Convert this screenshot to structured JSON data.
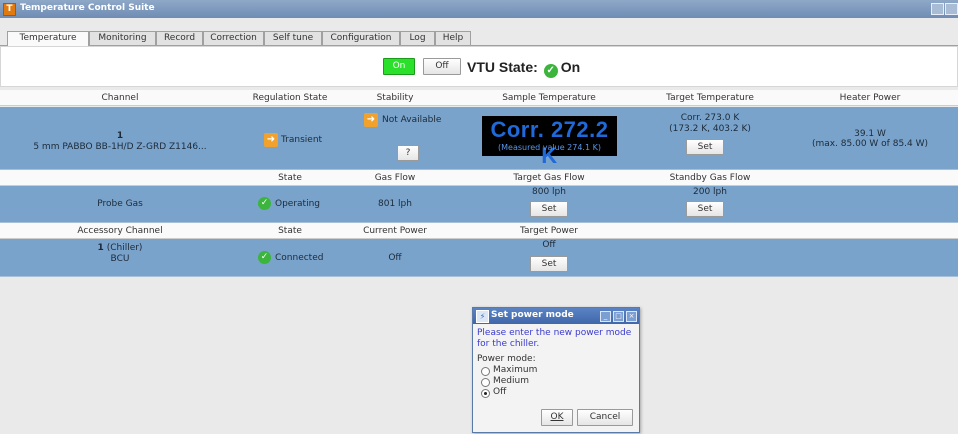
{
  "window": {
    "title": "Temperature Control Suite",
    "app_icon": "T"
  },
  "tabs": [
    {
      "label": "Temperature"
    },
    {
      "label": "Monitoring"
    },
    {
      "label": "Record"
    },
    {
      "label": "Correction"
    },
    {
      "label": "Self tune"
    },
    {
      "label": "Configuration"
    },
    {
      "label": "Log"
    },
    {
      "label": "Help"
    }
  ],
  "vtu": {
    "on_label": "On",
    "off_label": "Off",
    "state_label": "VTU State:",
    "state_value": "On"
  },
  "channel_header": {
    "channel": "Channel",
    "regulation_state": "Regulation State",
    "stability": "Stability",
    "sample_temperature": "Sample Temperature",
    "target_temperature": "Target Temperature",
    "heater_power": "Heater Power"
  },
  "channel_row": {
    "number": "1",
    "name": "5 mm PABBO BB-1H/D Z-GRD Z1146...",
    "regulation_state": "Transient",
    "stability": "Not Available",
    "stability_button": "?",
    "sample_corr": "Corr. 272.2 K",
    "sample_measured": "(Measured value 274.1 K)",
    "target_corr": "Corr. 273.0 K",
    "target_range": "(173.2 K, 403.2 K)",
    "target_set": "Set",
    "heater_power": "39.1 W",
    "heater_max": "(max. 85.00 W of 85.4 W)"
  },
  "gas_header": {
    "state": "State",
    "gas_flow": "Gas Flow",
    "target_gas_flow": "Target Gas Flow",
    "standby_gas_flow": "Standby Gas Flow"
  },
  "gas_row": {
    "name": "Probe Gas",
    "state": "Operating",
    "gas_flow": "801 lph",
    "target_gas_flow": "800 lph",
    "target_set": "Set",
    "standby_gas_flow": "200 lph",
    "standby_set": "Set"
  },
  "accessory_header": {
    "channel": "Accessory Channel",
    "state": "State",
    "current_power": "Current Power",
    "target_power": "Target Power"
  },
  "accessory_row": {
    "number": "1",
    "name_suffix": "(Chiller)",
    "unit": "BCU",
    "state": "Connected",
    "current_power": "Off",
    "target_power": "Off",
    "target_set": "Set"
  },
  "dialog": {
    "title": "Set power mode",
    "message": "Please enter the new power mode for the chiller.",
    "label": "Power mode:",
    "options": [
      {
        "label": "Maximum",
        "selected": false
      },
      {
        "label": "Medium",
        "selected": false
      },
      {
        "label": "Off",
        "selected": true
      }
    ],
    "ok_label": "OK",
    "cancel_label": "Cancel"
  },
  "colors": {
    "row": "#7aa3cc",
    "on_button": "#2be02b",
    "sample_text": "#1f6ad8",
    "check": "#3bb53b",
    "arrow": "#f0a22d"
  }
}
